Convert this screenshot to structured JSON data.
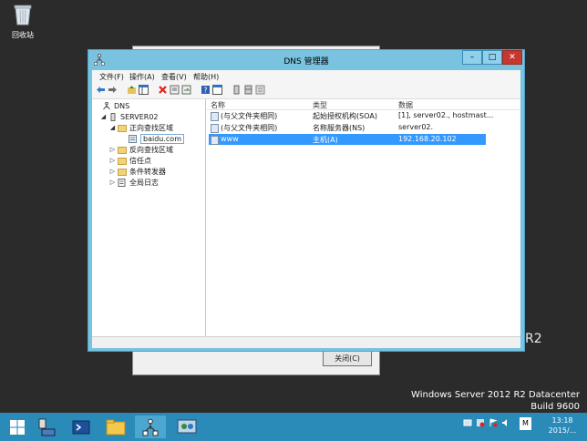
{
  "desktop": {
    "recycle_bin_label": "回收站",
    "os_line1": "Windows Server 2012 R2 Datacenter",
    "os_line2": "Build 9600",
    "edge_text": "R2"
  },
  "background_dialog": {
    "close_label": "关闭(C)"
  },
  "window": {
    "title": "DNS 管理器",
    "menu": [
      "文件(F)",
      "操作(A)",
      "查看(V)",
      "帮助(H)"
    ],
    "buttons": {
      "minimize": "–",
      "maximize": "□",
      "close": "✕"
    }
  },
  "tree": {
    "root": "DNS",
    "server": "SERVER02",
    "forward_zones": "正向查找区域",
    "zone": "baidu.com",
    "reverse_zones": "反向查找区域",
    "trust_points": "信任点",
    "conditional_forwarders": "条件转发器",
    "global_logs": "全局日志"
  },
  "list": {
    "columns": [
      "名称",
      "类型",
      "数据"
    ],
    "rows": [
      {
        "name": "(与父文件夹相同)",
        "type": "起始授权机构(SOA)",
        "data": "[1], server02., hostmast..."
      },
      {
        "name": "(与父文件夹相同)",
        "type": "名称服务器(NS)",
        "data": "server02."
      },
      {
        "name": "www",
        "type": "主机(A)",
        "data": "192.168.20.102"
      }
    ],
    "selected_row": 2
  },
  "taskbar": {
    "tray_input": "M",
    "time": "13:18",
    "date": "2015/..."
  },
  "colors": {
    "window_frame": "#79c3e0",
    "taskbar": "#2a8ab8",
    "selection": "#3399ff",
    "desktop": "#2b2b2b"
  }
}
